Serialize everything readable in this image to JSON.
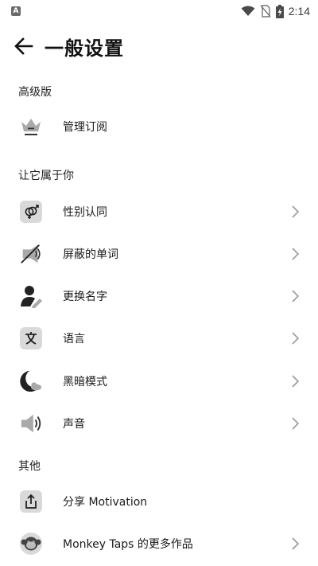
{
  "status_bar": {
    "notification_badge": "A",
    "time": "2:14",
    "icons": [
      "wifi-icon",
      "no-sim-icon",
      "battery-charging-icon"
    ]
  },
  "header": {
    "back_icon": "arrow-left-icon",
    "title": "一般设置"
  },
  "sections": {
    "premium": {
      "title": "高级版",
      "items": [
        {
          "label": "管理订阅",
          "icon": "crown-icon",
          "chevron": false
        }
      ]
    },
    "personalize": {
      "title": "让它属于你",
      "items": [
        {
          "label": "性别认同",
          "icon": "gender-icon",
          "chevron": true
        },
        {
          "label": "屏蔽的单词",
          "icon": "muted-words-icon",
          "chevron": true
        },
        {
          "label": "更换名字",
          "icon": "edit-name-icon",
          "chevron": true
        },
        {
          "label": "语言",
          "icon": "language-icon",
          "chevron": true
        },
        {
          "label": "黑暗模式",
          "icon": "dark-mode-icon",
          "chevron": true
        },
        {
          "label": "声音",
          "icon": "sound-icon",
          "chevron": true
        }
      ]
    },
    "other": {
      "title": "其他",
      "items": [
        {
          "label": "分享 Motivation",
          "icon": "share-icon",
          "chevron": false
        },
        {
          "label": "Monkey Taps 的更多作品",
          "icon": "monkey-icon",
          "chevron": true
        }
      ]
    }
  }
}
